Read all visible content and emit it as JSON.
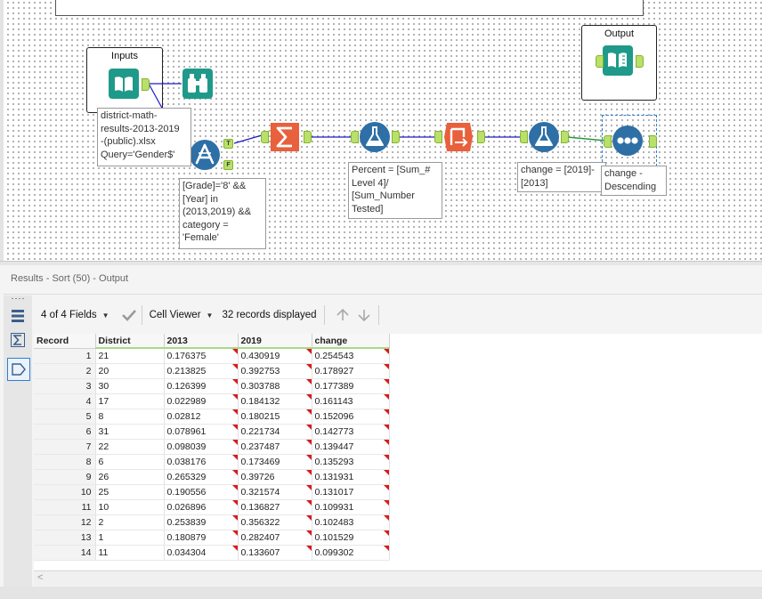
{
  "canvas": {
    "containers": {
      "inputs_title": "Inputs",
      "output_title": "Output"
    },
    "tools": [
      {
        "name": "input-data-tool",
        "icon": "book-icon",
        "color": "#1f9a8a"
      },
      {
        "name": "browse-tool",
        "icon": "binoculars-icon",
        "color": "#1f9a8a"
      },
      {
        "name": "filter-tool",
        "icon": "filter-icon",
        "color": "#2e6fa6"
      },
      {
        "name": "summarize-tool",
        "icon": "sigma-icon",
        "color": "#e8603c"
      },
      {
        "name": "formula-tool-1",
        "icon": "flask-icon",
        "color": "#2e6fa6"
      },
      {
        "name": "cross-tab-tool",
        "icon": "crosstab-icon",
        "color": "#e8603c"
      },
      {
        "name": "formula-tool-2",
        "icon": "flask-icon",
        "color": "#2e6fa6"
      },
      {
        "name": "sort-tool",
        "icon": "sort-dots-icon",
        "color": "#2e6fa6"
      },
      {
        "name": "output-data-tool",
        "icon": "book-icon",
        "color": "#1f9a8a"
      }
    ],
    "filter_anchors": {
      "true": "T",
      "false": "F"
    },
    "annotations": {
      "input": "district-math-\nresults-2013-2019\n-(public).xlsx\nQuery='Gender$'",
      "filter": "[Grade]='8' &&\n[Year] in\n(2013,2019) &&\ncategory =\n'Female'",
      "formula1": "Percent = [Sum_#\nLevel 4]/\n[Sum_Number\nTested]",
      "formula2": "change = [2019]-\n[2013]",
      "sort": "change -\nDescending"
    },
    "colors": {
      "wire": "#1a1acb",
      "wire_selected": "#2a9a3a",
      "selection": "#2b7fd6"
    }
  },
  "results": {
    "title": "Results - Sort (50) - Output",
    "fields_label": "4 of 4 Fields",
    "viewer_label": "Cell Viewer",
    "records_label": "32 records displayed",
    "side_icons": [
      "rows-icon",
      "sigma-icon",
      "tag-icon"
    ],
    "columns": [
      "Record",
      "District",
      "2013",
      "2019",
      "change"
    ],
    "rows": [
      [
        "1",
        "21",
        "0.176375",
        "0.430919",
        "0.254543"
      ],
      [
        "2",
        "20",
        "0.213825",
        "0.392753",
        "0.178927"
      ],
      [
        "3",
        "30",
        "0.126399",
        "0.303788",
        "0.177389"
      ],
      [
        "4",
        "17",
        "0.022989",
        "0.184132",
        "0.161143"
      ],
      [
        "5",
        "8",
        "0.02812",
        "0.180215",
        "0.152096"
      ],
      [
        "6",
        "31",
        "0.078961",
        "0.221734",
        "0.142773"
      ],
      [
        "7",
        "22",
        "0.098039",
        "0.237487",
        "0.139447"
      ],
      [
        "8",
        "6",
        "0.038176",
        "0.173469",
        "0.135293"
      ],
      [
        "9",
        "26",
        "0.265329",
        "0.39726",
        "0.131931"
      ],
      [
        "10",
        "25",
        "0.190556",
        "0.321574",
        "0.131017"
      ],
      [
        "11",
        "10",
        "0.026896",
        "0.136827",
        "0.109931"
      ],
      [
        "12",
        "2",
        "0.253839",
        "0.356322",
        "0.102483"
      ],
      [
        "13",
        "1",
        "0.180879",
        "0.282407",
        "0.101529"
      ],
      [
        "14",
        "11",
        "0.034304",
        "0.133607",
        "0.099302"
      ]
    ],
    "colors": {
      "header_underline": "#a8d98a",
      "flag": "#d81b1b"
    }
  }
}
